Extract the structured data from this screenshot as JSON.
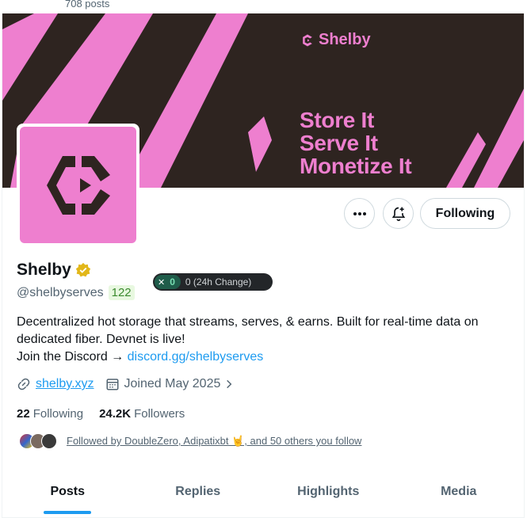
{
  "header": {
    "post_count": "708 posts"
  },
  "banner": {
    "logo_text": "Shelby",
    "tagline": [
      "Store It",
      "Serve It",
      "Monetize It"
    ],
    "background_color": "#2e2420",
    "accent_color": "#ee7fcf"
  },
  "profile": {
    "display_name": "Shelby",
    "handle": "@shelbyserves",
    "handle_badge": "122",
    "verified_icon": "verified-gold-badge-icon",
    "chip": {
      "count": "0",
      "change_text": "0 (24h Change)"
    },
    "bio_line1": "Decentralized hot storage that streams, serves, & earns. Built for real-time data on",
    "bio_line2": "dedicated fiber. Devnet is live!",
    "bio_line3_prefix": "Join the Discord → ",
    "bio_link": "discord.gg/shelbyserves",
    "website": "shelby.xyz",
    "joined": "Joined May 2025",
    "following_count": "22",
    "following_label": "Following",
    "followers_count": "24.2K",
    "followers_label": "Followers",
    "followed_by": "Followed by DoubleZero, Adipatixbt 🤘, and 50 others you follow"
  },
  "actions": {
    "more_icon": "more-icon",
    "notify_icon": "bell-plus-icon",
    "follow_label": "Following"
  },
  "tabs": [
    {
      "label": "Posts",
      "active": true
    },
    {
      "label": "Replies",
      "active": false
    },
    {
      "label": "Highlights",
      "active": false
    },
    {
      "label": "Media",
      "active": false
    }
  ]
}
